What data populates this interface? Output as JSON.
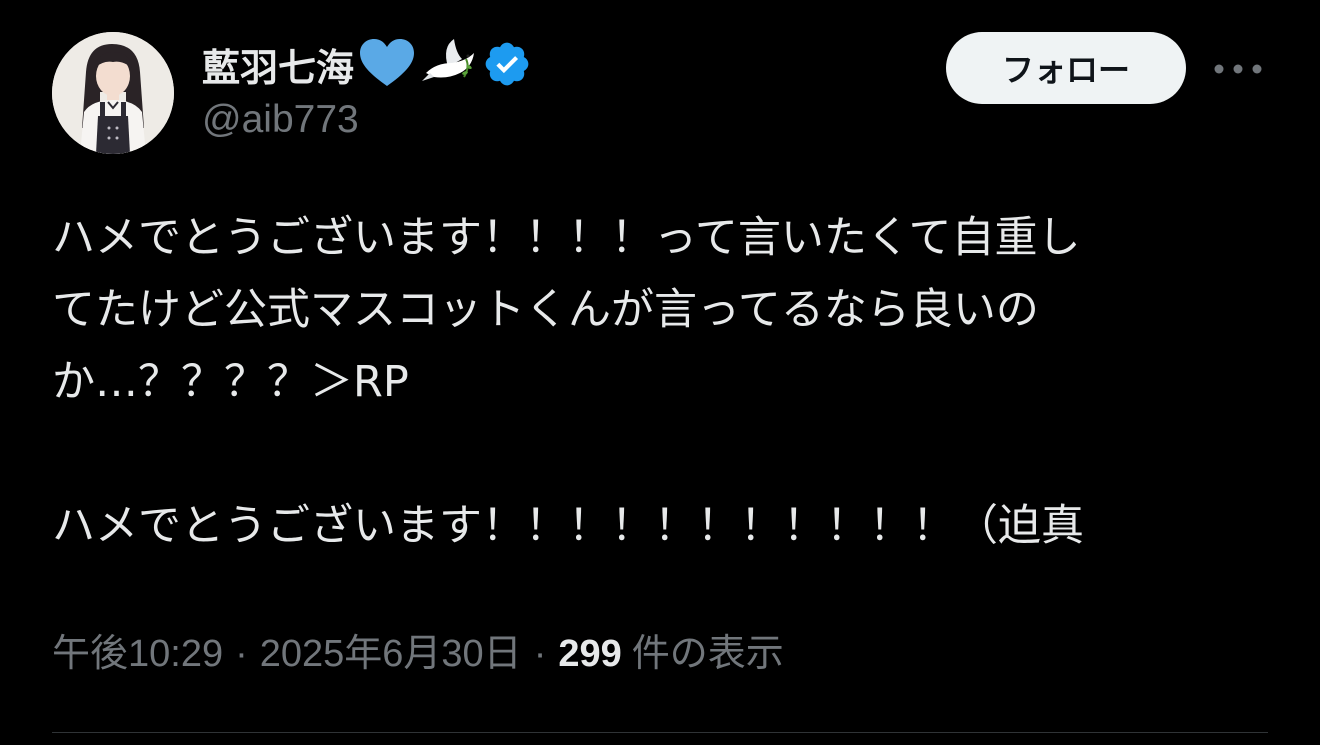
{
  "user": {
    "display_name": "藍羽七海",
    "emoji_heart": "blue-heart-icon",
    "emoji_dove": "dove-icon",
    "verified": true,
    "handle": "@aib773"
  },
  "actions": {
    "follow_label": "フォロー",
    "more_icon": "ellipsis-icon"
  },
  "tweet": {
    "lines": [
      "ハメでとうございます！！！！って言いたくて自重し",
      "てたけど公式マスコットくんが言ってるなら良いの",
      "か…？？？？＞RP",
      "ハメでとうございます！！！！！！！！！！！（迫真"
    ]
  },
  "meta": {
    "time": "午後10:29",
    "separator": "·",
    "date": "2025年6月30日",
    "views_count": "299",
    "views_label": "件の表示"
  },
  "colors": {
    "background": "#000000",
    "text": "#e7e9ea",
    "secondary": "#71767b",
    "verified_blue": "#1d9bf0",
    "heart_blue": "#5aa9e6",
    "follow_bg": "#eff3f4"
  }
}
